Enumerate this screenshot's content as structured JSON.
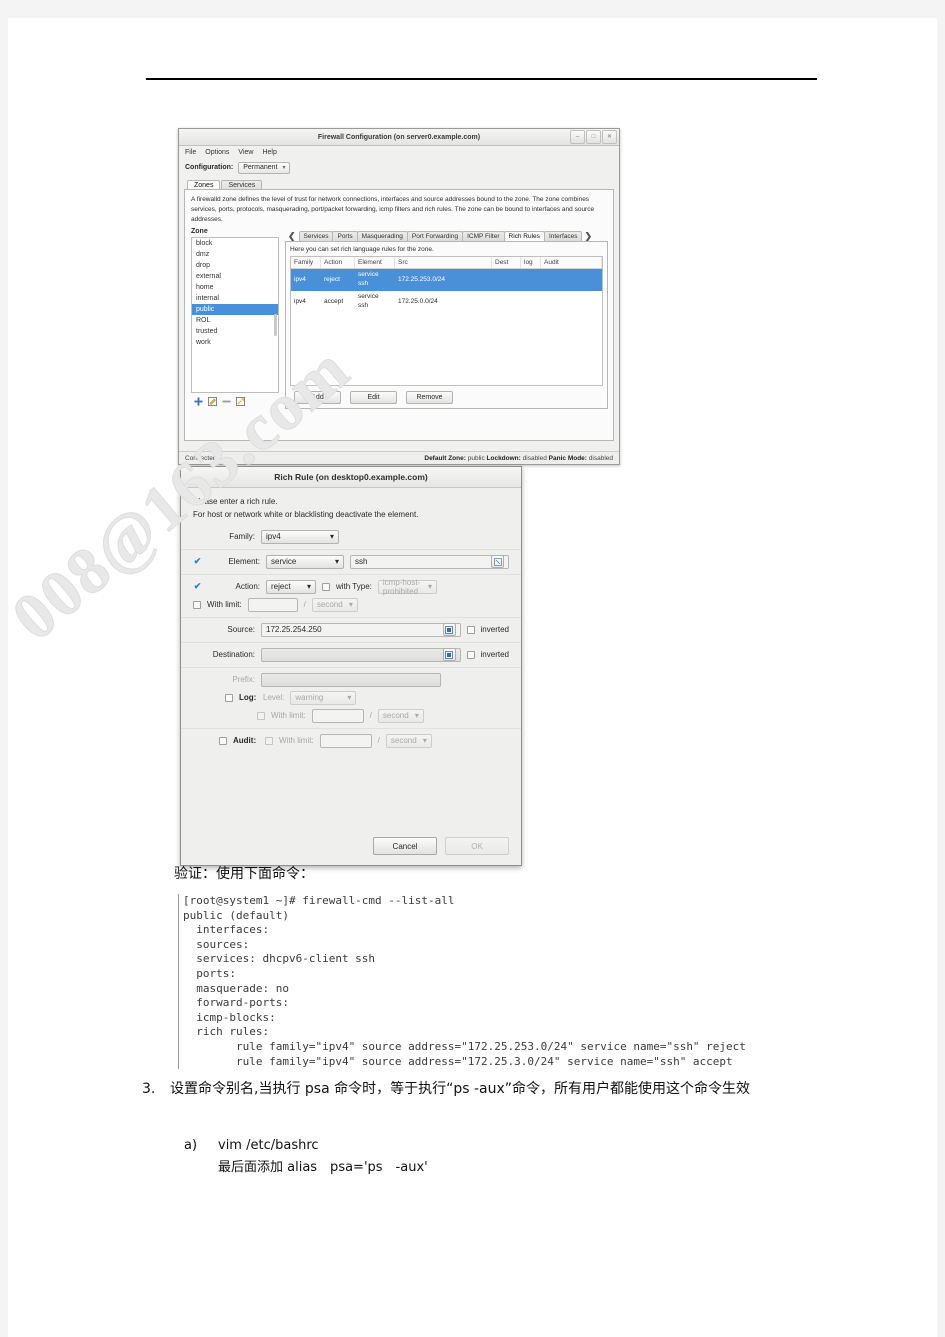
{
  "watermark": "008@163.com",
  "firewall_window": {
    "title": "Firewall Configuration (on server0.example.com)",
    "window_buttons": [
      "minimize-icon",
      "maximize-icon",
      "close-icon"
    ],
    "menu": [
      "File",
      "Options",
      "View",
      "Help"
    ],
    "configuration_label": "Configuration:",
    "configuration_value": "Permanent",
    "top_tabs": [
      {
        "label": "Zones",
        "active": true
      },
      {
        "label": "Services",
        "active": false
      }
    ],
    "description": "A firewalld zone defines the level of trust for network connections, interfaces and source addresses bound to the zone. The zone combines services, ports, protocols, masquerading, port/packet forwarding, icmp filters and rich rules. The zone can be bound to interfaces and source addresses.",
    "zone_header": "Zone",
    "zones": [
      {
        "label": "block",
        "selected": false
      },
      {
        "label": "dmz",
        "selected": false
      },
      {
        "label": "drop",
        "selected": false
      },
      {
        "label": "external",
        "selected": false
      },
      {
        "label": "home",
        "selected": false
      },
      {
        "label": "internal",
        "selected": false
      },
      {
        "label": "public",
        "selected": true
      },
      {
        "label": "ROL",
        "selected": false
      },
      {
        "label": "trusted",
        "selected": false
      },
      {
        "label": "work",
        "selected": false
      }
    ],
    "zone_tools": [
      "add-zone-icon",
      "edit-zone-icon",
      "remove-zone-icon",
      "load-defaults-icon"
    ],
    "sub_tabs": [
      {
        "label": "Services",
        "active": false
      },
      {
        "label": "Ports",
        "active": false
      },
      {
        "label": "Masquerading",
        "active": false
      },
      {
        "label": "Port Forwarding",
        "active": false
      },
      {
        "label": "ICMP Filter",
        "active": false
      },
      {
        "label": "Rich Rules",
        "active": true
      },
      {
        "label": "Interfaces",
        "active": false
      }
    ],
    "scroll_left_icon": "chevron-left-icon",
    "scroll_right_icon": "chevron-right-icon",
    "rich_rules_hint": "Here you can set rich language rules for the zone.",
    "rich_rules_columns": [
      "Family",
      "Action",
      "Element",
      "Src",
      "Dest",
      "log",
      "Audit"
    ],
    "rich_rules_rows": [
      {
        "family": "ipv4",
        "action": "reject",
        "element": "service\nssh",
        "src": "172.25.253.0/24",
        "dest": "",
        "log": "",
        "audit": "",
        "selected": true
      },
      {
        "family": "ipv4",
        "action": "accept",
        "element": "service\nssh",
        "src": "172.25.0.0/24",
        "dest": "",
        "log": "",
        "audit": "",
        "selected": false
      }
    ],
    "rule_buttons": [
      "Add",
      "Edit",
      "Remove"
    ],
    "status_left": "Connected.",
    "status_default_zone_label": "Default Zone:",
    "status_default_zone_value": "public",
    "status_lockdown_label": "Lockdown:",
    "status_lockdown_value": "disabled",
    "status_panic_label": "Panic Mode:",
    "status_panic_value": "disabled"
  },
  "rich_rule_dialog": {
    "title": "Rich Rule (on desktop0.example.com)",
    "intro_line1": "Please enter a rich rule.",
    "intro_line2": "For host or network white or blacklisting deactivate the element.",
    "family_label": "Family:",
    "family_value": "ipv4",
    "element_label": "Element:",
    "element_checked": true,
    "element_type": "service",
    "element_value": "ssh",
    "element_picker_icon": "picker-icon",
    "action_label": "Action:",
    "action_checked": true,
    "action_value": "reject",
    "with_type_label": "with Type:",
    "with_type_checked": false,
    "with_type_value": "icmp-host-prohibited",
    "action_with_limit_label": "With limit:",
    "action_with_limit_checked": false,
    "action_limit_value": "",
    "action_limit_unit": "second",
    "source_label": "Source:",
    "source_value": "172.25.254.250",
    "source_picker_icon": "picker-icon",
    "source_inverted_label": "inverted",
    "source_inverted_checked": false,
    "destination_label": "Destination:",
    "destination_value": "",
    "destination_picker_icon": "picker-icon",
    "destination_inverted_label": "inverted",
    "destination_inverted_checked": false,
    "prefix_label": "Prefix:",
    "prefix_value": "",
    "log_label": "Log:",
    "log_checked": false,
    "level_label": "Level:",
    "level_value": "warning",
    "log_with_limit_label": "With limit:",
    "log_limit_value": "",
    "log_limit_unit": "second",
    "audit_label": "Audit:",
    "audit_checked": false,
    "audit_with_limit_label": "With limit:",
    "audit_limit_value": "",
    "audit_limit_unit": "second",
    "cancel_label": "Cancel",
    "ok_label": "OK",
    "slash": "/"
  },
  "document": {
    "verify_line": "验证：使用下面命令：",
    "terminal": "[root@system1 ~]# firewall-cmd --list-all\npublic (default)\n  interfaces:\n  sources:\n  services: dhcpv6-client ssh\n  ports:\n  masquerade: no\n  forward-ports:\n  icmp-blocks:\n  rich rules:\n        rule family=\"ipv4\" source address=\"172.25.253.0/24\" service name=\"ssh\" reject\n        rule family=\"ipv4\" source address=\"172.25.3.0/24\" service name=\"ssh\" accept",
    "item3_number": "3.",
    "item3_text": "设置命令别名,当执行 psa 命令时，等于执行“ps -aux”命令，所有用户都能使用这个命令生效",
    "sub_a_marker": "a)",
    "sub_a_text": "vim /etc/bashrc",
    "sub_a_detail": "最后面添加 alias　psa='ps　-aux'"
  }
}
